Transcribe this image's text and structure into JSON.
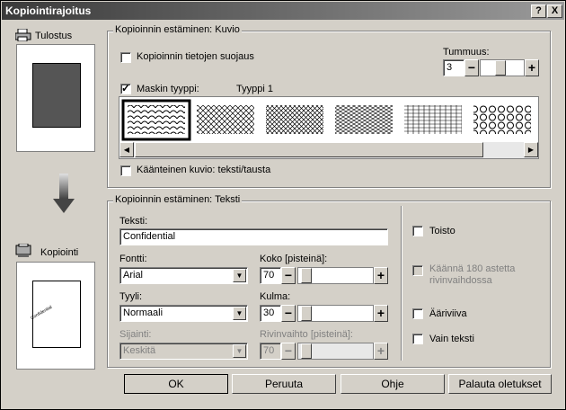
{
  "title": "Kopiointirajoitus",
  "title_buttons": {
    "help": "?",
    "close": "X"
  },
  "left": {
    "print_label": "Tulostus",
    "copy_label": "Kopiointi",
    "sample_text": "Confidential"
  },
  "pattern_group": {
    "legend": "Kopioinnin estäminen: Kuvio",
    "protect_label": "Kopioinnin tietojen suojaus",
    "density_label": "Tummuus:",
    "density_value": "3",
    "mask_label": "Maskin tyyppi:",
    "mask_value": "Tyyppi 1",
    "reverse_label": "Käänteinen kuvio: teksti/tausta"
  },
  "text_group": {
    "legend": "Kopioinnin estäminen: Teksti",
    "text_label": "Teksti:",
    "text_value": "Confidential",
    "font_label": "Fontti:",
    "font_value": "Arial",
    "size_label": "Koko [pisteinä]:",
    "size_value": "70",
    "style_label": "Tyyli:",
    "style_value": "Normaali",
    "angle_label": "Kulma:",
    "angle_value": "30",
    "position_label": "Sijainti:",
    "position_value": "Keskitä",
    "linespacing_label": "Rivinvaihto [pisteinä]:",
    "linespacing_value": "70",
    "repeat_label": "Toisto",
    "rotate_label": "Käännä 180 astetta rivinvaihdossa",
    "outline_label": "Ääriviiva",
    "textonly_label": "Vain teksti"
  },
  "buttons": {
    "ok": "OK",
    "cancel": "Peruuta",
    "help": "Ohje",
    "defaults": "Palauta oletukset"
  }
}
